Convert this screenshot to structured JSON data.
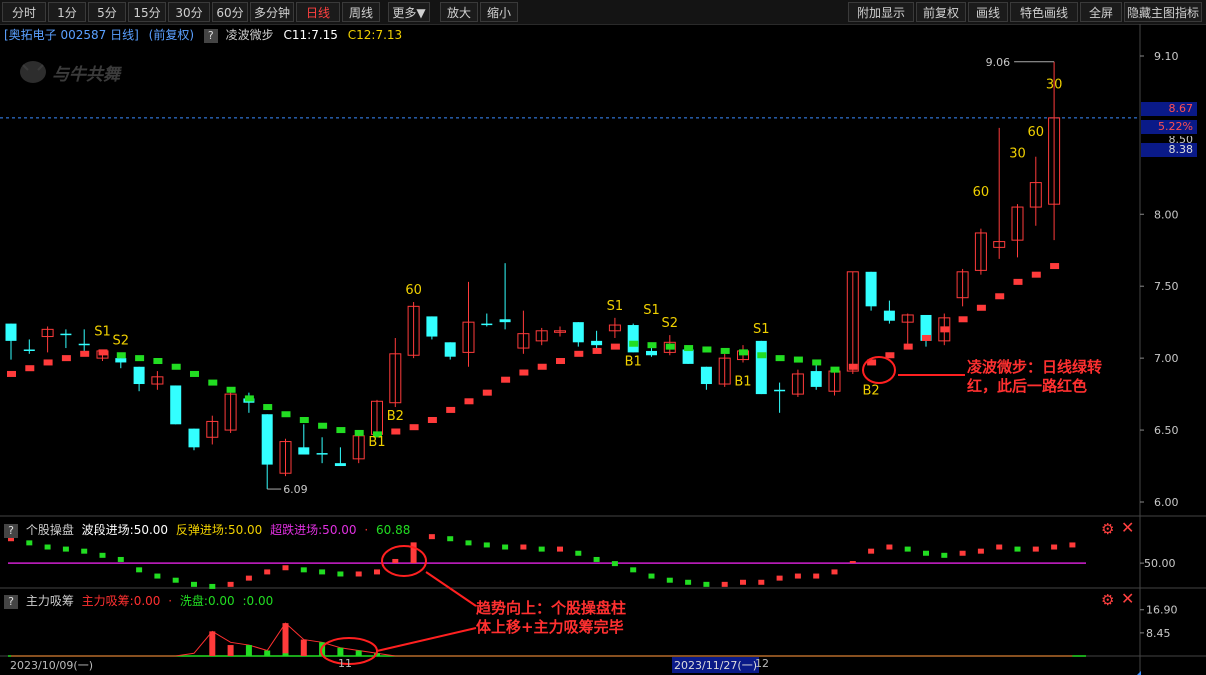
{
  "toolbar": {
    "left": [
      "分时",
      "1分",
      "5分",
      "15分",
      "30分",
      "60分",
      "多分钟",
      "日线",
      "周线",
      "更多▼",
      "放大",
      "缩小"
    ],
    "active": "日线",
    "right": [
      "附加显示",
      "前复权",
      "画线",
      "特色画线",
      "全屏",
      "隐藏主图指标"
    ]
  },
  "main_info": {
    "stock": "[奥拓电子 002587 日线]",
    "adjust": "(前复权)",
    "q": "?",
    "indicator": "凌波微步",
    "c11": "C11:7.15",
    "c12": "C12:7.13"
  },
  "watermark": "与牛共舞",
  "price_boxes": {
    "last": "8.67",
    "pct": "5.22%",
    "hidden": "8.50",
    "prev": "8.38"
  },
  "panel2": {
    "q": "?",
    "name": "个股操盘",
    "f1": "波段进场:50.00",
    "f2": "反弹进场:50.00",
    "f3": "超跌进场:50.00",
    "f4": "60.88",
    "dash": "·"
  },
  "panel3": {
    "q": "?",
    "name": "主力吸筹",
    "f1": "主力吸筹:0.00",
    "f2": "洗盘:0.00",
    "f3": ":0.00",
    "dash": "·"
  },
  "annotations": {
    "right": [
      "凌波微步：日线绿转",
      "红，此后一路红色"
    ],
    "bottom": [
      "趋势向上：个股操盘柱",
      "体上移+主力吸筹完毕"
    ]
  },
  "dates": {
    "start": "2023/10/09(一)",
    "mid": "2023/11/27(一)",
    "mid_suffix": "12",
    "tick11": "11"
  },
  "colors": {
    "up": "#ff3b3b",
    "down": "#33ffff",
    "green": "#22dd22",
    "magenta": "#d020d0",
    "yellow": "#f0d000",
    "bg": "#000000"
  },
  "icons": [
    "gear-icon",
    "close-icon"
  ],
  "chart_data": {
    "type": "candlestick",
    "ylim": [
      6.0,
      9.1
    ],
    "yticks": [
      6.0,
      6.5,
      7.0,
      7.5,
      8.0,
      9.1
    ],
    "ytick_labels": [
      "6.00",
      "6.50",
      "7.00",
      "7.50",
      "8.00",
      "9.10"
    ],
    "max_label": "9.06",
    "min_label": "6.09",
    "candles": [
      {
        "o": 7.12,
        "h": 7.24,
        "l": 6.99,
        "c": 7.24,
        "up": false
      },
      {
        "o": 7.06,
        "h": 7.13,
        "l": 7.03,
        "c": 7.06,
        "up": false
      },
      {
        "o": 7.15,
        "h": 7.22,
        "l": 7.04,
        "c": 7.2,
        "up": true
      },
      {
        "o": 7.17,
        "h": 7.2,
        "l": 7.07,
        "c": 7.16,
        "up": false
      },
      {
        "o": 7.1,
        "h": 7.2,
        "l": 7.05,
        "c": 7.1,
        "up": false
      },
      {
        "o": 7.0,
        "h": 7.06,
        "l": 6.98,
        "c": 7.05,
        "up": true
      },
      {
        "o": 7.0,
        "h": 7.02,
        "l": 6.93,
        "c": 6.97,
        "up": false
      },
      {
        "o": 6.94,
        "h": 6.94,
        "l": 6.77,
        "c": 6.82,
        "up": false
      },
      {
        "o": 6.82,
        "h": 6.91,
        "l": 6.78,
        "c": 6.87,
        "up": true
      },
      {
        "o": 6.81,
        "h": 6.81,
        "l": 6.54,
        "c": 6.54,
        "up": false
      },
      {
        "o": 6.51,
        "h": 6.51,
        "l": 6.36,
        "c": 6.38,
        "up": false
      },
      {
        "o": 6.45,
        "h": 6.6,
        "l": 6.4,
        "c": 6.56,
        "up": true
      },
      {
        "o": 6.5,
        "h": 6.77,
        "l": 6.48,
        "c": 6.75,
        "up": true
      },
      {
        "o": 6.72,
        "h": 6.76,
        "l": 6.62,
        "c": 6.69,
        "up": false
      },
      {
        "o": 6.61,
        "h": 6.61,
        "l": 6.09,
        "c": 6.26,
        "up": false
      },
      {
        "o": 6.2,
        "h": 6.44,
        "l": 6.18,
        "c": 6.42,
        "up": true
      },
      {
        "o": 6.38,
        "h": 6.54,
        "l": 6.34,
        "c": 6.33,
        "up": false
      },
      {
        "o": 6.34,
        "h": 6.45,
        "l": 6.27,
        "c": 6.34,
        "up": false
      },
      {
        "o": 6.27,
        "h": 6.38,
        "l": 6.25,
        "c": 6.25,
        "up": false
      },
      {
        "o": 6.3,
        "h": 6.49,
        "l": 6.27,
        "c": 6.46,
        "up": true
      },
      {
        "o": 6.47,
        "h": 6.71,
        "l": 6.45,
        "c": 6.7,
        "up": true
      },
      {
        "o": 6.69,
        "h": 7.14,
        "l": 6.66,
        "c": 7.03,
        "up": true
      },
      {
        "o": 7.02,
        "h": 7.39,
        "l": 7.0,
        "c": 7.36,
        "up": true
      },
      {
        "o": 7.29,
        "h": 7.29,
        "l": 7.13,
        "c": 7.15,
        "up": false
      },
      {
        "o": 7.11,
        "h": 7.11,
        "l": 6.99,
        "c": 7.01,
        "up": false
      },
      {
        "o": 7.04,
        "h": 7.53,
        "l": 6.94,
        "c": 7.25,
        "up": true
      },
      {
        "o": 7.24,
        "h": 7.31,
        "l": 7.22,
        "c": 7.24,
        "up": false
      },
      {
        "o": 7.27,
        "h": 7.66,
        "l": 7.2,
        "c": 7.25,
        "up": false
      },
      {
        "o": 7.07,
        "h": 7.33,
        "l": 7.03,
        "c": 7.17,
        "up": true
      },
      {
        "o": 7.12,
        "h": 7.21,
        "l": 7.09,
        "c": 7.19,
        "up": true
      },
      {
        "o": 7.19,
        "h": 7.22,
        "l": 7.15,
        "c": 7.19,
        "up": true
      },
      {
        "o": 7.25,
        "h": 7.25,
        "l": 7.08,
        "c": 7.11,
        "up": false
      },
      {
        "o": 7.12,
        "h": 7.19,
        "l": 7.06,
        "c": 7.09,
        "up": false
      },
      {
        "o": 7.19,
        "h": 7.28,
        "l": 7.14,
        "c": 7.23,
        "up": true
      },
      {
        "o": 7.23,
        "h": 7.24,
        "l": 7.04,
        "c": 7.04,
        "up": false
      },
      {
        "o": 7.05,
        "h": 7.1,
        "l": 7.01,
        "c": 7.02,
        "up": false
      },
      {
        "o": 7.04,
        "h": 7.16,
        "l": 7.02,
        "c": 7.11,
        "up": true
      },
      {
        "o": 7.06,
        "h": 7.08,
        "l": 6.96,
        "c": 6.96,
        "up": false
      },
      {
        "o": 6.94,
        "h": 6.94,
        "l": 6.78,
        "c": 6.82,
        "up": false
      },
      {
        "o": 6.82,
        "h": 7.03,
        "l": 6.8,
        "c": 7.0,
        "up": true
      },
      {
        "o": 6.99,
        "h": 7.09,
        "l": 6.97,
        "c": 7.05,
        "up": true
      },
      {
        "o": 7.12,
        "h": 7.12,
        "l": 6.75,
        "c": 6.75,
        "up": false
      },
      {
        "o": 6.78,
        "h": 6.83,
        "l": 6.62,
        "c": 6.78,
        "up": false
      },
      {
        "o": 6.75,
        "h": 6.92,
        "l": 6.73,
        "c": 6.89,
        "up": true
      },
      {
        "o": 6.91,
        "h": 6.98,
        "l": 6.78,
        "c": 6.8,
        "up": false
      },
      {
        "o": 6.77,
        "h": 6.93,
        "l": 6.74,
        "c": 6.91,
        "up": true
      },
      {
        "o": 6.91,
        "h": 7.6,
        "l": 6.89,
        "c": 7.6,
        "up": true
      },
      {
        "o": 7.6,
        "h": 7.6,
        "l": 7.33,
        "c": 7.36,
        "up": false
      },
      {
        "o": 7.33,
        "h": 7.4,
        "l": 7.24,
        "c": 7.26,
        "up": false
      },
      {
        "o": 7.25,
        "h": 7.31,
        "l": 7.1,
        "c": 7.3,
        "up": true
      },
      {
        "o": 7.3,
        "h": 7.3,
        "l": 7.08,
        "c": 7.12,
        "up": false
      },
      {
        "o": 7.12,
        "h": 7.31,
        "l": 7.09,
        "c": 7.28,
        "up": true
      },
      {
        "o": 7.42,
        "h": 7.62,
        "l": 7.36,
        "c": 7.6,
        "up": true
      },
      {
        "o": 7.61,
        "h": 7.9,
        "l": 7.58,
        "c": 7.87,
        "up": true
      },
      {
        "o": 7.77,
        "h": 8.6,
        "l": 7.69,
        "c": 7.81,
        "up": true
      },
      {
        "o": 7.82,
        "h": 8.07,
        "l": 7.7,
        "c": 8.05,
        "up": true
      },
      {
        "o": 8.05,
        "h": 8.4,
        "l": 7.92,
        "c": 8.22,
        "up": true
      },
      {
        "o": 8.07,
        "h": 9.06,
        "l": 7.82,
        "c": 8.67,
        "up": true
      }
    ],
    "lb_markers": [
      {
        "v": 6.89,
        "c": "r"
      },
      {
        "v": 6.93,
        "c": "r"
      },
      {
        "v": 6.97,
        "c": "r"
      },
      {
        "v": 7.0,
        "c": "r"
      },
      {
        "v": 7.03,
        "c": "r"
      },
      {
        "v": 7.04,
        "c": "r"
      },
      {
        "v": 7.02,
        "c": "g"
      },
      {
        "v": 7.0,
        "c": "g"
      },
      {
        "v": 6.98,
        "c": "g"
      },
      {
        "v": 6.94,
        "c": "g"
      },
      {
        "v": 6.89,
        "c": "g"
      },
      {
        "v": 6.83,
        "c": "g"
      },
      {
        "v": 6.78,
        "c": "g"
      },
      {
        "v": 6.72,
        "c": "g"
      },
      {
        "v": 6.66,
        "c": "g"
      },
      {
        "v": 6.61,
        "c": "g"
      },
      {
        "v": 6.57,
        "c": "g"
      },
      {
        "v": 6.53,
        "c": "g"
      },
      {
        "v": 6.5,
        "c": "g"
      },
      {
        "v": 6.48,
        "c": "g"
      },
      {
        "v": 6.47,
        "c": "g"
      },
      {
        "v": 6.49,
        "c": "r"
      },
      {
        "v": 6.52,
        "c": "r"
      },
      {
        "v": 6.57,
        "c": "r"
      },
      {
        "v": 6.64,
        "c": "r"
      },
      {
        "v": 6.7,
        "c": "r"
      },
      {
        "v": 6.76,
        "c": "r"
      },
      {
        "v": 6.85,
        "c": "r"
      },
      {
        "v": 6.9,
        "c": "r"
      },
      {
        "v": 6.94,
        "c": "r"
      },
      {
        "v": 6.98,
        "c": "r"
      },
      {
        "v": 7.03,
        "c": "r"
      },
      {
        "v": 7.05,
        "c": "r"
      },
      {
        "v": 7.08,
        "c": "r"
      },
      {
        "v": 7.1,
        "c": "g"
      },
      {
        "v": 7.09,
        "c": "g"
      },
      {
        "v": 7.08,
        "c": "g"
      },
      {
        "v": 7.07,
        "c": "g"
      },
      {
        "v": 7.06,
        "c": "g"
      },
      {
        "v": 7.05,
        "c": "g"
      },
      {
        "v": 7.04,
        "c": "g"
      },
      {
        "v": 7.02,
        "c": "g"
      },
      {
        "v": 7.0,
        "c": "g"
      },
      {
        "v": 6.99,
        "c": "g"
      },
      {
        "v": 6.97,
        "c": "g"
      },
      {
        "v": 6.92,
        "c": "g"
      },
      {
        "v": 6.94,
        "c": "r"
      },
      {
        "v": 6.97,
        "c": "r"
      },
      {
        "v": 7.02,
        "c": "r"
      },
      {
        "v": 7.08,
        "c": "r"
      },
      {
        "v": 7.14,
        "c": "r"
      },
      {
        "v": 7.2,
        "c": "r"
      },
      {
        "v": 7.27,
        "c": "r"
      },
      {
        "v": 7.35,
        "c": "r"
      },
      {
        "v": 7.43,
        "c": "r"
      },
      {
        "v": 7.53,
        "c": "r"
      },
      {
        "v": 7.58,
        "c": "r"
      },
      {
        "v": 7.64,
        "c": "r"
      }
    ],
    "labels": [
      {
        "i": 5,
        "v": 7.1,
        "t": "S1",
        "pos": "above"
      },
      {
        "i": 6,
        "v": 7.04,
        "t": "S2",
        "pos": "above"
      },
      {
        "i": 20,
        "v": 6.5,
        "t": "B1",
        "pos": "below"
      },
      {
        "i": 21,
        "v": 6.68,
        "t": "B2",
        "pos": "below"
      },
      {
        "i": 22,
        "v": 7.39,
        "t": "60",
        "pos": "above"
      },
      {
        "i": 33,
        "v": 7.28,
        "t": "S1",
        "pos": "above"
      },
      {
        "i": 34,
        "v": 7.06,
        "t": "B1",
        "pos": "below"
      },
      {
        "i": 35,
        "v": 7.25,
        "t": "S1",
        "pos": "above"
      },
      {
        "i": 36,
        "v": 7.16,
        "t": "S2",
        "pos": "above"
      },
      {
        "i": 41,
        "v": 7.12,
        "t": "S1",
        "pos": "above"
      },
      {
        "i": 40,
        "v": 6.92,
        "t": "B1",
        "pos": "below"
      },
      {
        "i": 47,
        "v": 6.86,
        "t": "B2",
        "pos": "below"
      },
      {
        "i": 53,
        "v": 8.07,
        "t": "60",
        "pos": "above"
      },
      {
        "i": 55,
        "v": 8.34,
        "t": "30",
        "pos": "above"
      },
      {
        "i": 56,
        "v": 8.49,
        "t": "60",
        "pos": "above"
      },
      {
        "i": 57,
        "v": 8.82,
        "t": "30",
        "pos": "above"
      }
    ],
    "sub1": {
      "ylim": [
        38,
        65
      ],
      "tick": 50.0,
      "tick_label": "50.00",
      "bars": [
        62,
        60,
        58,
        57,
        56,
        54,
        52,
        47,
        44,
        42,
        40,
        39,
        40,
        43,
        46,
        48,
        47,
        46,
        45,
        45,
        46,
        52,
        60,
        63,
        62,
        60,
        59,
        58,
        58,
        57,
        57,
        55,
        52,
        50,
        47,
        44,
        42,
        41,
        40,
        40,
        41,
        41,
        43,
        44,
        44,
        46,
        51,
        56,
        58,
        57,
        55,
        54,
        55,
        56,
        58,
        57,
        57,
        58,
        59
      ]
    },
    "sub2": {
      "ylim": [
        0,
        19
      ],
      "ticks": [
        16.9,
        8.45
      ],
      "tick_labels": [
        "16.90",
        "8.45"
      ],
      "red": [
        0,
        0,
        0,
        0,
        0,
        0,
        0,
        0,
        0,
        0,
        0,
        9,
        4,
        0,
        0,
        12,
        6,
        0,
        0,
        0,
        0,
        0,
        0,
        0,
        0,
        0,
        0,
        0,
        0,
        0,
        0,
        0,
        0,
        0,
        0,
        0,
        0,
        0,
        0,
        0,
        0,
        0,
        0,
        0,
        0,
        0,
        0,
        0,
        0,
        0,
        0,
        0,
        0,
        0,
        0,
        0,
        0,
        0,
        0
      ],
      "green": [
        0,
        0,
        0,
        0,
        0,
        0,
        0,
        0,
        0,
        0,
        0,
        0,
        0,
        4,
        2,
        1,
        0,
        5,
        3,
        2,
        1,
        0,
        0,
        0,
        0,
        0,
        0,
        0,
        0,
        0,
        0,
        0,
        0,
        0,
        0,
        0,
        0,
        0,
        0,
        0,
        0,
        0,
        0,
        0,
        0,
        0,
        0,
        0,
        0,
        0,
        0,
        0,
        0,
        0,
        0,
        0,
        0,
        0,
        0
      ],
      "line": [
        0,
        0,
        0,
        0,
        0,
        0,
        0,
        0,
        0,
        0,
        1,
        9,
        5,
        4,
        2,
        12,
        6,
        5,
        3,
        2,
        1,
        0,
        0,
        0,
        0,
        0,
        0,
        0,
        0,
        0,
        0,
        0,
        0,
        0,
        0,
        0,
        0,
        0,
        0,
        0,
        0,
        0,
        0,
        0,
        0,
        0,
        0,
        0,
        0,
        0,
        0,
        0,
        0,
        0,
        0,
        0,
        0,
        0,
        0
      ]
    }
  }
}
